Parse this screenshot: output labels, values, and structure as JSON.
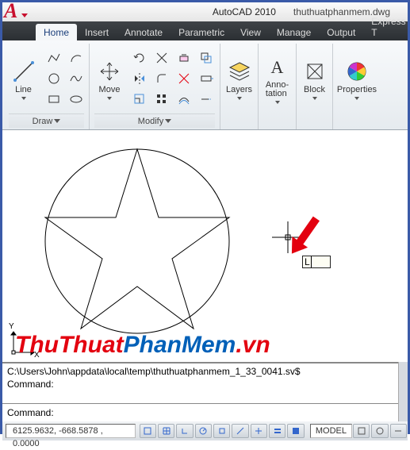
{
  "title": {
    "app": "AutoCAD 2010",
    "file": "thuthuatphanmem.dwg"
  },
  "tabs": [
    "Home",
    "Insert",
    "Annotate",
    "Parametric",
    "View",
    "Manage",
    "Output",
    "Express T"
  ],
  "ribbon": {
    "draw": {
      "title": "Draw",
      "line": "Line"
    },
    "modify": {
      "title": "Modify",
      "move": "Move"
    },
    "layers": {
      "title": "Layers"
    },
    "annotation": {
      "title": "Anno-\ntation"
    },
    "block": {
      "title": "Block"
    },
    "properties": {
      "title": "Properties"
    }
  },
  "canvas": {
    "axis_x": "X",
    "axis_y": "Y",
    "dynamic_input": "L",
    "watermark": {
      "p1": "ThuThuat",
      "p2": "PhanMem",
      "p3": ".vn"
    }
  },
  "cmd": {
    "history1": "C:\\Users\\John\\appdata\\local\\temp\\thuthuatphanmem_1_33_0041.sv$",
    "history2": "Command:",
    "prompt": "Command:",
    "input": ""
  },
  "status": {
    "coords": "6125.9632, -668.5878 , 0.0000",
    "model": "MODEL"
  }
}
